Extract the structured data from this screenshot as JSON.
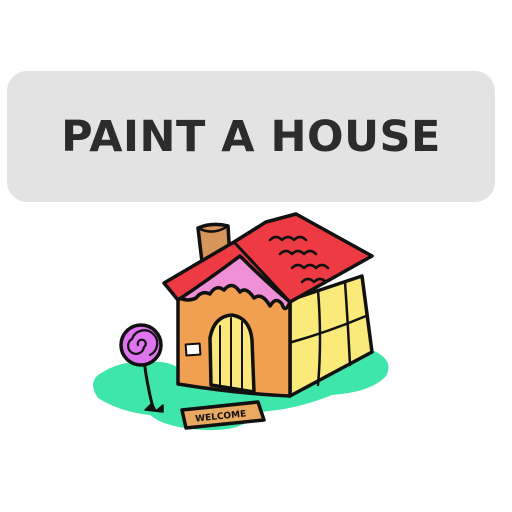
{
  "title_button": {
    "label": "PAINT A HOUSE"
  },
  "house": {
    "doormat_text": "WELCOME",
    "colors": {
      "roof": "#ee3a43",
      "frosting": "#ef8fd6",
      "front_wall": "#f0a050",
      "side_wall": "#f9ea7a",
      "door": "#fbe77b",
      "chimney": "#d6955a",
      "doormat": "#e9a961",
      "grass": "#3ee7a9",
      "lollipop": "#e074f0",
      "outline": "#111111"
    }
  }
}
